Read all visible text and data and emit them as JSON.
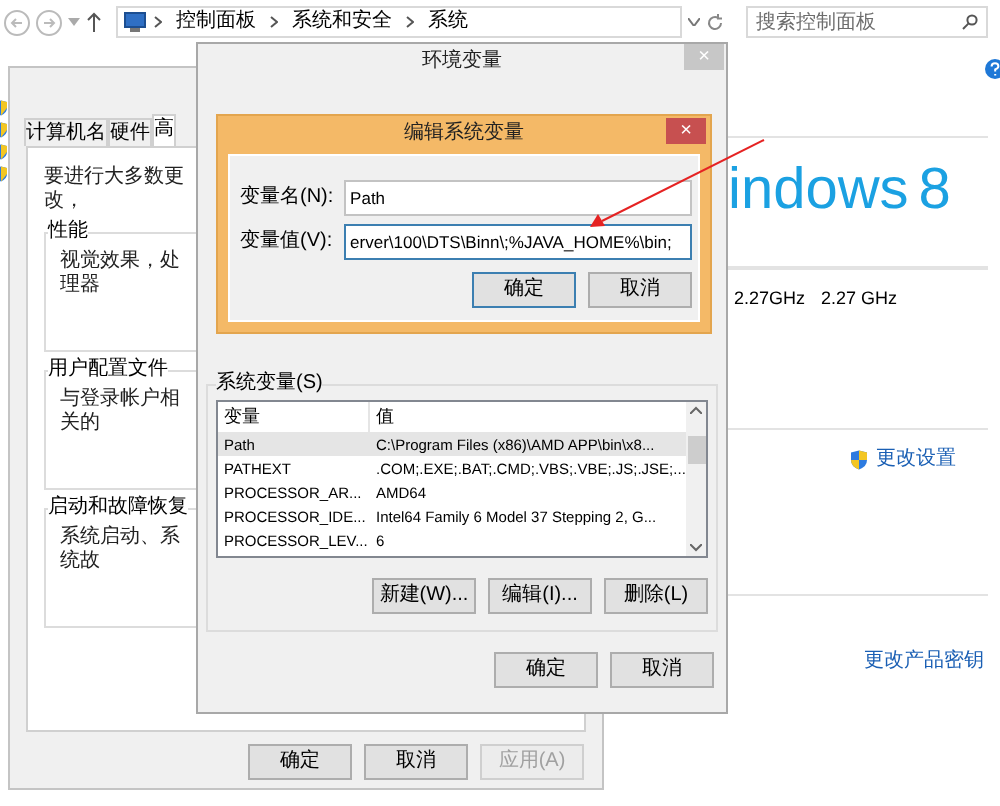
{
  "explorer": {
    "breadcrumb": [
      "控制面板",
      "系统和安全",
      "系统"
    ],
    "search": {
      "placeholder": "搜索控制面板"
    },
    "logo": {
      "word": "indows",
      "version": "8"
    },
    "cpu": [
      "2.27GHz",
      "2.27 GHz"
    ],
    "links": [
      "更改设置",
      "更改产品密钥"
    ]
  },
  "system_properties": {
    "tabs": [
      {
        "label": "计算机名",
        "selected": false
      },
      {
        "label": "硬件",
        "selected": false
      },
      {
        "label": "高",
        "selected": true
      }
    ],
    "intro": "要进行大多数更改，",
    "groups": [
      {
        "title": "性能",
        "text": "视觉效果，处理器"
      },
      {
        "title": "用户配置文件",
        "text": "与登录帐户相关的"
      },
      {
        "title": "启动和故障恢复",
        "text": "系统启动、系统故"
      }
    ],
    "buttons": [
      {
        "label": "确定",
        "disabled": false
      },
      {
        "label": "取消",
        "disabled": false
      },
      {
        "label": "应用(A)",
        "disabled": true
      }
    ]
  },
  "environment_variables": {
    "title": "环境变量",
    "close": "×",
    "system_label": "系统变量(S)",
    "columns": [
      "变量",
      "值"
    ],
    "rows": [
      {
        "name": "Path",
        "value": "C:\\Program Files (x86)\\AMD APP\\bin\\x8...",
        "selected": true
      },
      {
        "name": "PATHEXT",
        "value": ".COM;.EXE;.BAT;.CMD;.VBS;.VBE;.JS;.JSE;...",
        "selected": false
      },
      {
        "name": "PROCESSOR_AR...",
        "value": "AMD64",
        "selected": false
      },
      {
        "name": "PROCESSOR_IDE...",
        "value": "Intel64 Family 6 Model 37 Stepping 2, G...",
        "selected": false
      },
      {
        "name": "PROCESSOR_LEV...",
        "value": "6",
        "selected": false
      }
    ],
    "list_buttons": [
      "新建(W)...",
      "编辑(I)...",
      "删除(L)"
    ],
    "buttons": [
      "确定",
      "取消"
    ]
  },
  "edit_dialog": {
    "title": "编辑系统变量",
    "close": "×",
    "fields": [
      {
        "label": "变量名(N):",
        "value": "Path",
        "focused": false
      },
      {
        "label": "变量值(V):",
        "value": "erver\\100\\DTS\\Binn\\;%JAVA_HOME%\\bin;",
        "focused": true
      }
    ],
    "buttons": [
      {
        "label": "确定",
        "default": true
      },
      {
        "label": "取消",
        "default": false
      }
    ]
  }
}
